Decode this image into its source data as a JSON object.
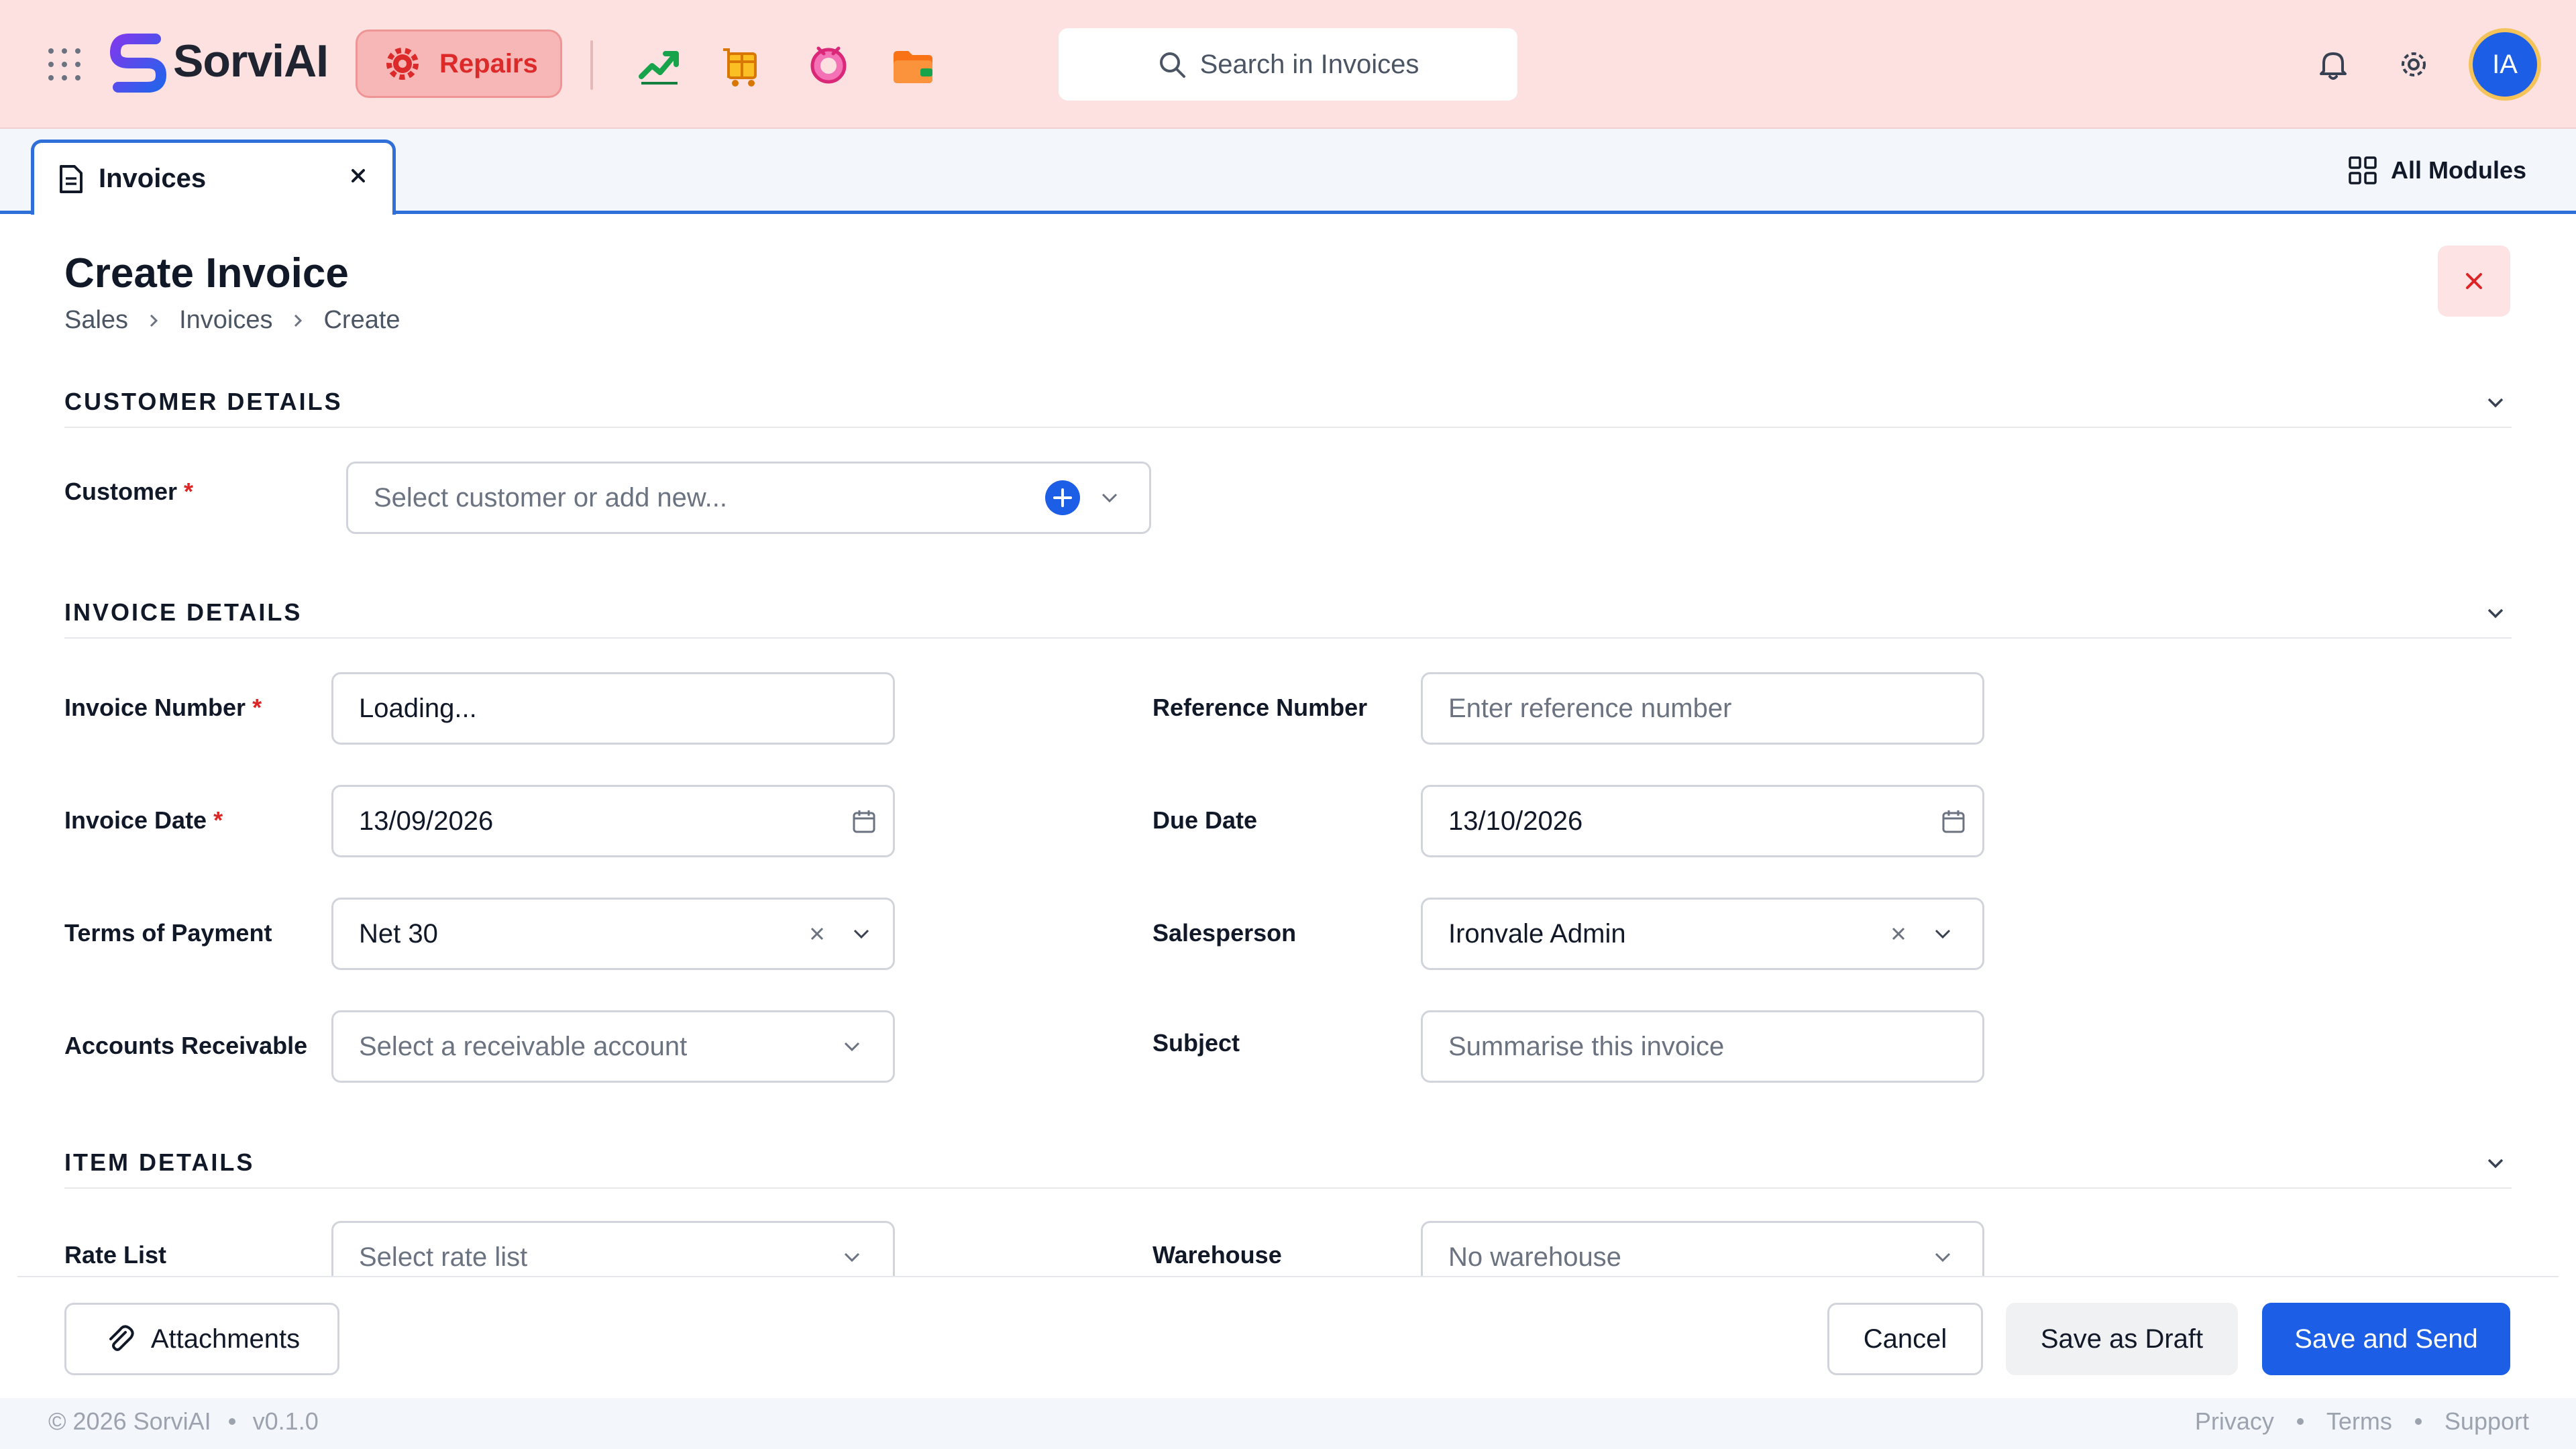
{
  "brand": {
    "name": "SorviAI"
  },
  "module": {
    "active_label": "Repairs"
  },
  "search": {
    "placeholder": "Search in Invoices"
  },
  "user": {
    "initials": "IA"
  },
  "tabs": [
    {
      "label": "Invoices"
    }
  ],
  "all_modules_label": "All Modules",
  "page": {
    "title": "Create Invoice",
    "breadcrumb": [
      "Sales",
      "Invoices",
      "Create"
    ]
  },
  "sections": {
    "customer": {
      "title": "CUSTOMER DETAILS",
      "customer_label": "Customer",
      "customer_placeholder": "Select customer or add new..."
    },
    "invoice": {
      "title": "INVOICE DETAILS",
      "invoice_number_label": "Invoice Number",
      "invoice_number_value": "Loading...",
      "reference_number_label": "Reference Number",
      "reference_number_placeholder": "Enter reference number",
      "invoice_date_label": "Invoice Date",
      "invoice_date_value": "13/09/2026",
      "due_date_label": "Due Date",
      "due_date_value": "13/10/2026",
      "terms_label": "Terms of Payment",
      "terms_value": "Net 30",
      "salesperson_label": "Salesperson",
      "salesperson_value": "Ironvale Admin",
      "ar_label": "Accounts Receivable",
      "ar_placeholder": "Select a receivable account",
      "subject_label": "Subject",
      "subject_placeholder": "Summarise this invoice"
    },
    "items": {
      "title": "ITEM DETAILS",
      "rate_list_label": "Rate List",
      "rate_list_placeholder": "Select rate list",
      "warehouse_label": "Warehouse",
      "warehouse_placeholder": "No warehouse"
    }
  },
  "actions": {
    "attachments": "Attachments",
    "cancel": "Cancel",
    "save_draft": "Save as Draft",
    "save_send": "Save and Send"
  },
  "footer": {
    "copyright": "© 2026 SorviAI",
    "version": "v0.1.0",
    "links": [
      "Privacy",
      "Terms",
      "Support"
    ]
  },
  "colors": {
    "topbar_bg": "#fde1e1",
    "accent_blue": "#1d5ee6",
    "repairs_red": "#dc2a2a",
    "required_red": "#dc2626"
  }
}
